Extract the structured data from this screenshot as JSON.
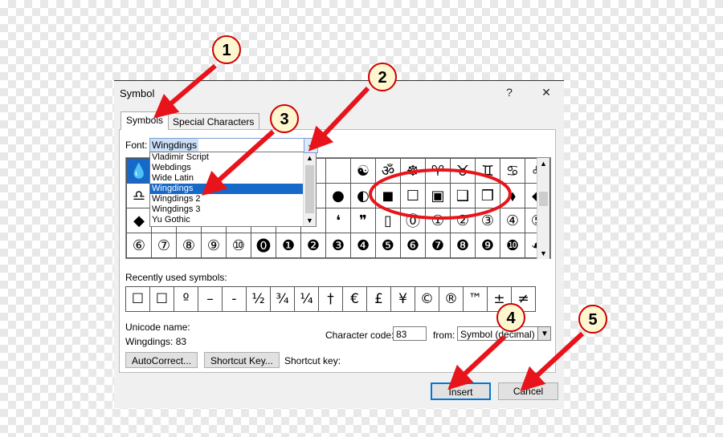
{
  "dialog": {
    "title": "Symbol",
    "help": "?",
    "close": "✕",
    "tabs": [
      "Symbols",
      "Special Characters"
    ]
  },
  "font": {
    "label": "Font:",
    "value": "Wingdings",
    "dropdown_items": [
      "Vladimir Script",
      "Webdings",
      "Wide Latin",
      "Wingdings",
      "Wingdings 2",
      "Wingdings 3",
      "Yu Gothic"
    ],
    "selected": "Wingdings"
  },
  "grid_rows": [
    [
      "💧",
      "",
      "",
      "",
      "",
      "",
      "",
      "",
      "",
      "☯",
      "ॐ",
      "☸",
      "♈",
      "♉",
      "♊",
      "♋",
      "♌",
      "♍"
    ],
    [
      "♎",
      "",
      "",
      "",
      "",
      "",
      "",
      "",
      "",
      "●",
      "◐",
      "◼",
      "☐",
      "▣",
      "❑",
      "❒",
      "⬧",
      "◆"
    ],
    [
      "◆",
      "",
      "",
      "",
      "",
      "",
      "",
      "",
      "",
      "❛",
      "❞",
      "▯",
      "⓪",
      "①",
      "②",
      "③",
      "④",
      "⑤"
    ],
    [
      "⑥",
      "⑦",
      "⑧",
      "⑨",
      "⑩",
      "⓿",
      "❶",
      "❷",
      "❸",
      "❹",
      "❺",
      "❻",
      "❼",
      "❽",
      "❾",
      "❿",
      "☙"
    ]
  ],
  "grid_visible": [
    [
      "💧",
      "",
      "",
      "",
      "",
      "",
      "",
      "",
      "",
      "☯",
      "ॐ",
      "☸",
      "♈",
      "♉",
      "♊",
      "♋",
      "♌"
    ],
    [
      "♎",
      "",
      "",
      "",
      "",
      "",
      "",
      "",
      "●",
      "◐",
      "◼",
      "☐",
      "▣",
      "❑",
      "❒",
      "⬧",
      "◆"
    ],
    [
      "◆",
      "",
      "",
      "",
      "",
      "",
      "",
      "",
      "❛",
      "❞",
      "▯",
      "⓪",
      "①",
      "②",
      "③",
      "④",
      "⑤"
    ],
    [
      "⑥",
      "⑦",
      "⑧",
      "⑨",
      "⑩",
      "⓿",
      "❶",
      "❷",
      "❸",
      "❹",
      "❺",
      "❻",
      "❼",
      "❽",
      "❾",
      "❿",
      "☙"
    ]
  ],
  "recent": {
    "label": "Recently used symbols:",
    "symbols": [
      "☐",
      "☐",
      "º",
      "–",
      "-",
      "½",
      "¾",
      "¼",
      "†",
      "€",
      "£",
      "¥",
      "©",
      "®",
      "™",
      "±",
      "≠"
    ]
  },
  "unicode": {
    "label": "Unicode name:",
    "value": "Wingdings: 83"
  },
  "char_code": {
    "label": "Character code:",
    "value": "83",
    "from_label": "from:",
    "from_value": "Symbol (decimal)"
  },
  "buttons": {
    "autocorrect": "AutoCorrect...",
    "shortcut_key": "Shortcut Key...",
    "shortcut_label": "Shortcut key:",
    "insert": "Insert",
    "cancel": "Cancel"
  },
  "callouts": [
    "1",
    "2",
    "3",
    "4",
    "5"
  ],
  "colors": {
    "arrow": "#e8141b",
    "selection": "#1769c9",
    "callout_fill": "#fff7cf"
  }
}
